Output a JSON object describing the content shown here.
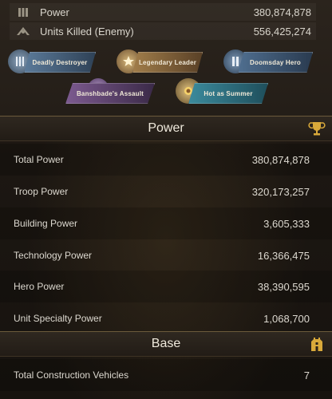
{
  "top_stats": [
    {
      "label": "Power",
      "value": "380,874,878",
      "icon": "power-bars-icon"
    },
    {
      "label": "Units Killed (Enemy)",
      "value": "556,425,274",
      "icon": "kills-icon"
    }
  ],
  "badges": [
    {
      "label": "Deadly Destroyer",
      "color": "#4f6a86"
    },
    {
      "label": "Legendary Leader",
      "color": "#8a6a3c"
    },
    {
      "label": "Doomsday Hero",
      "color": "#3f5d7c"
    },
    {
      "label": "Banshbade's Assault",
      "color": "#6a4f7a"
    },
    {
      "label": "Hot as Summer",
      "color": "#2e6f80"
    }
  ],
  "power_section": {
    "title": "Power",
    "icon": "trophy-icon",
    "rows": [
      {
        "label": "Total Power",
        "value": "380,874,878"
      },
      {
        "label": "Troop Power",
        "value": "320,173,257"
      },
      {
        "label": "Building Power",
        "value": "3,605,333"
      },
      {
        "label": "Technology Power",
        "value": "16,366,475"
      },
      {
        "label": "Hero Power",
        "value": "38,390,595"
      },
      {
        "label": "Unit Specialty Power",
        "value": "1,068,700"
      }
    ]
  },
  "base_section": {
    "title": "Base",
    "icon": "base-icon",
    "rows": [
      {
        "label": "Total Construction Vehicles",
        "value": "7"
      }
    ]
  }
}
